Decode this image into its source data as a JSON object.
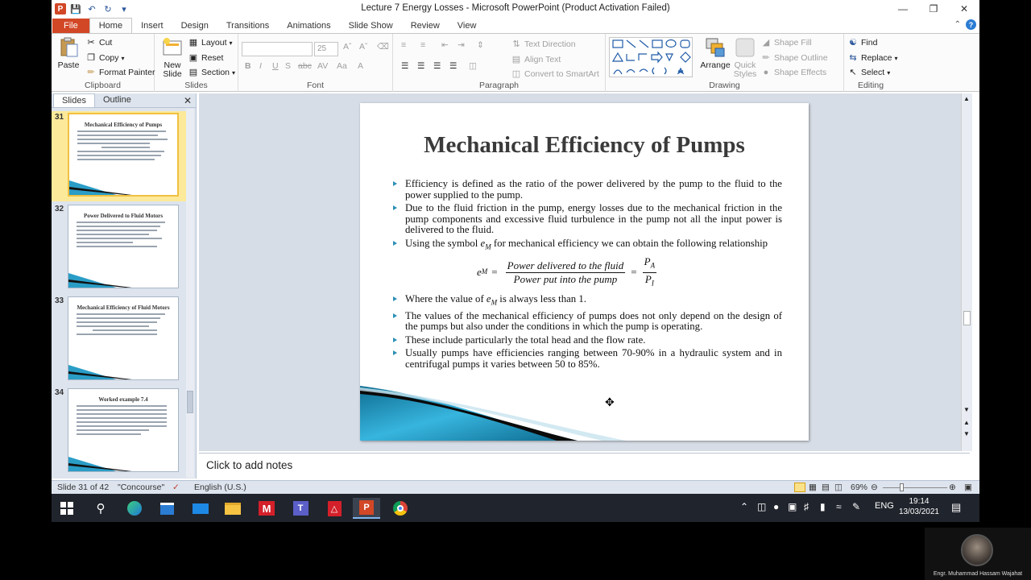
{
  "window": {
    "title": "Lecture 7 Energy Losses - Microsoft PowerPoint (Product Activation Failed)"
  },
  "tabs": [
    "File",
    "Home",
    "Insert",
    "Design",
    "Transitions",
    "Animations",
    "Slide Show",
    "Review",
    "View"
  ],
  "active_tab": "Home",
  "ribbon": {
    "clipboard": {
      "label": "Clipboard",
      "paste": "Paste",
      "cut": "Cut",
      "copy": "Copy",
      "format_painter": "Format Painter"
    },
    "slides": {
      "label": "Slides",
      "new_slide": "New Slide",
      "layout": "Layout",
      "reset": "Reset",
      "section": "Section"
    },
    "font": {
      "label": "Font",
      "size": "25"
    },
    "paragraph": {
      "label": "Paragraph",
      "text_direction": "Text Direction",
      "align_text": "Align Text",
      "convert_smartart": "Convert to SmartArt"
    },
    "drawing": {
      "label": "Drawing",
      "arrange": "Arrange",
      "quick_styles": "Quick Styles",
      "shape_fill": "Shape Fill",
      "shape_outline": "Shape Outline",
      "shape_effects": "Shape Effects"
    },
    "editing": {
      "label": "Editing",
      "find": "Find",
      "replace": "Replace",
      "select": "Select"
    }
  },
  "pane": {
    "tab_slides": "Slides",
    "tab_outline": "Outline",
    "thumbnails": [
      {
        "num": "31",
        "title": "Mechanical Efficiency of Pumps",
        "selected": true
      },
      {
        "num": "32",
        "title": "Power Delivered to Fluid Motors",
        "selected": false
      },
      {
        "num": "33",
        "title": "Mechanical Efficiency of Fluid Motors",
        "selected": false
      },
      {
        "num": "34",
        "title": "Worked example 7.4",
        "selected": false
      }
    ]
  },
  "slide": {
    "title": "Mechanical Efficiency of Pumps",
    "b1": "Efficiency is defined as the ratio of the power delivered by the pump to the fluid to the power supplied to the pump.",
    "b2": "Due to the fluid friction in the pump, energy losses due to the mechanical friction in the pump components and excessive fluid turbulence in the pump not all the input power is delivered to the fluid.",
    "b3_pre": "Using the symbol ",
    "b3_post": " for mechanical efficiency we can obtain the following relationship",
    "eq_lhs": "e",
    "eq_lhs_sub": "M",
    "eq_num": "Power delivered to the fluid",
    "eq_den": "Power put into the pump",
    "eq_pa": "P",
    "eq_pa_sub": "A",
    "eq_pi": "P",
    "eq_pi_sub": "I",
    "b4_pre": "Where the value of ",
    "b4_post": " is always  less than 1.",
    "b5": "The values of the mechanical efficiency of pumps does not only depend on the design of the pumps but also under the conditions in which the pump is operating.",
    "b6": "These include particularly the total head and the flow rate.",
    "b7": "Usually pumps have efficiencies ranging between 70-90% in a hydraulic system and in centrifugal pumps it varies between 50 to 85%."
  },
  "notes_placeholder": "Click to add notes",
  "status": {
    "slide_info": "Slide 31 of 42",
    "theme": "\"Concourse\"",
    "language": "English (U.S.)",
    "zoom": "69%"
  },
  "taskbar": {
    "lang": "ENG",
    "time": "19:14",
    "date": "13/03/2021"
  },
  "webcam_name": "Engr. Muhammad Hassam Wajahat"
}
